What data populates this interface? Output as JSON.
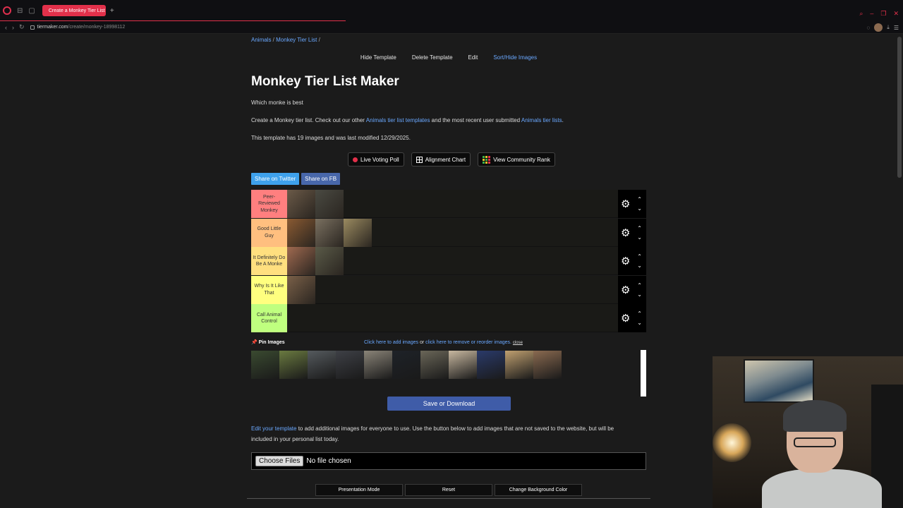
{
  "browser": {
    "tab_title": "Create a Monkey Tier List",
    "url_host": "tiermaker.com",
    "url_path": "/create/monkey-18998112"
  },
  "breadcrumb": [
    "Animals",
    "Monkey Tier List"
  ],
  "top_links": [
    "Hide Template",
    "Delete Template",
    "Edit",
    "Sort/Hide Images"
  ],
  "title": "Monkey Tier List Maker",
  "subtitle": "Which monke is best",
  "desc": {
    "pre": "Create a Monkey tier list. Check out our other ",
    "link1": "Animals tier list templates",
    "mid": " and the most recent user submitted ",
    "link2": "Animals tier lists",
    "post": "."
  },
  "template_info": "This template has 19 images and was last modified 12/29/2025.",
  "actions": [
    "Live Voting Poll",
    "Alignment Chart",
    "View Community Rank"
  ],
  "share": [
    "Share on Twitter",
    "Share on FB"
  ],
  "tiers": [
    {
      "label": "Peer-Reviewed Monkey",
      "color": "#ff7f7f",
      "items": 2
    },
    {
      "label": "Good Little Guy",
      "color": "#ffbf7f",
      "items": 3
    },
    {
      "label": "It Definitely Do Be A Monke",
      "color": "#ffdf7f",
      "items": 2
    },
    {
      "label": "Why Is It Like That",
      "color": "#ffff7f",
      "items": 1
    },
    {
      "label": "Call Animal Control",
      "color": "#bfff7f",
      "items": 0
    }
  ],
  "pin": {
    "label": "Pin Images",
    "add_link": "Click here to add images",
    "or": " or ",
    "remove_link": "click here to remove or reorder images.",
    "close": "close"
  },
  "save_label": "Save or Download",
  "edit_note": {
    "link": "Edit your template",
    "line1": " to add additional images for everyone to use. Use the button below to add images that are not saved to the website, but will be",
    "line2": "included in your personal list today."
  },
  "file_input": {
    "button": "Choose Files",
    "status": "No file chosen"
  },
  "bottom_buttons": [
    "Presentation Mode",
    "Reset",
    "Change Background Color"
  ]
}
